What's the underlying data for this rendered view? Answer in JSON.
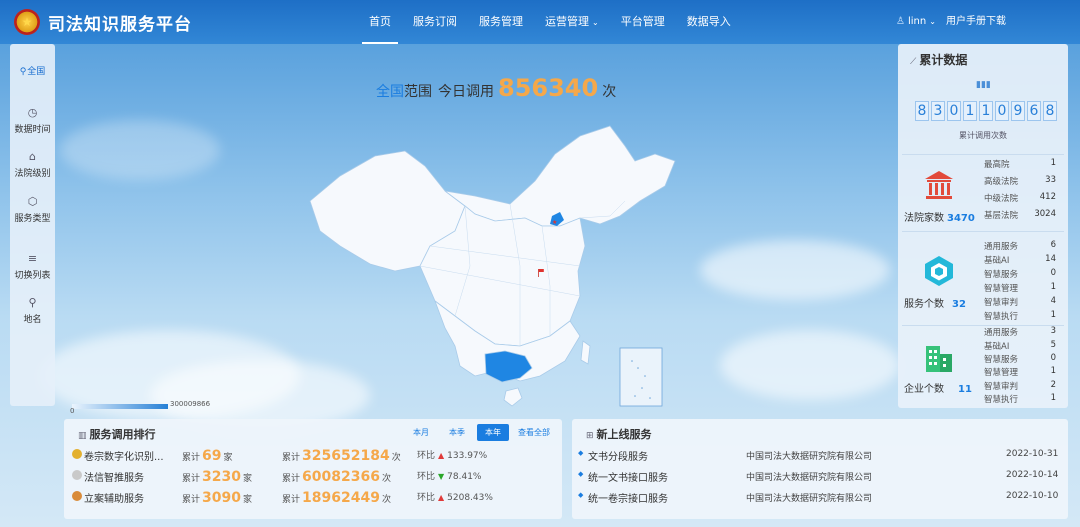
{
  "header": {
    "app_title": "司法知识服务平台",
    "nav": [
      {
        "label": "首页",
        "active": true
      },
      {
        "label": "服务订阅",
        "active": false
      },
      {
        "label": "服务管理",
        "active": false
      },
      {
        "label": "运营管理",
        "active": false,
        "dropdown": true
      },
      {
        "label": "平台管理",
        "active": false
      },
      {
        "label": "数据导入",
        "active": false
      }
    ],
    "username": "linn",
    "manual_link": "用户手册下载"
  },
  "sidebar": {
    "items": [
      {
        "label": "全国",
        "icon": "location-pin-icon"
      },
      {
        "label": "数据时间",
        "icon": "clock-icon"
      },
      {
        "label": "法院级别",
        "icon": "court-building-icon"
      },
      {
        "label": "服务类型",
        "icon": "hexagon-icon"
      },
      {
        "label": "切换列表",
        "icon": "list-icon"
      },
      {
        "label": "地名",
        "icon": "location-pin-icon"
      }
    ]
  },
  "map": {
    "scope": "全国",
    "scope_suffix": "范围",
    "prefix": "今日调用",
    "today_calls": "856340",
    "unit": "次",
    "legend_min": "0",
    "legend_max": "300009866",
    "highlight_color": "#1f86e3",
    "base_color": "#f6f9fd"
  },
  "cumulative": {
    "title": "累计数据",
    "total_digits": [
      "8",
      "3",
      "0",
      "1",
      "1",
      "0",
      "9",
      "6",
      "8"
    ],
    "total_label": "累计调用次数",
    "courts": {
      "label": "法院家数",
      "value": "3470",
      "items": [
        {
          "name": "最高院",
          "value": "1"
        },
        {
          "name": "高级法院",
          "value": "33"
        },
        {
          "name": "中级法院",
          "value": "412"
        },
        {
          "name": "基层法院",
          "value": "3024"
        }
      ]
    },
    "services": {
      "label": "服务个数",
      "value": "32",
      "items": [
        {
          "name": "通用服务",
          "value": "6"
        },
        {
          "name": "基础AI",
          "value": "14"
        },
        {
          "name": "智慧服务",
          "value": "0"
        },
        {
          "name": "智慧管理",
          "value": "1"
        },
        {
          "name": "智慧审判",
          "value": "4"
        },
        {
          "name": "智慧执行",
          "value": "1"
        }
      ]
    },
    "enterprises": {
      "label": "企业个数",
      "value": "11",
      "items": [
        {
          "name": "通用服务",
          "value": "3"
        },
        {
          "name": "基础AI",
          "value": "5"
        },
        {
          "name": "智慧服务",
          "value": "0"
        },
        {
          "name": "智慧管理",
          "value": "1"
        },
        {
          "name": "智慧审判",
          "value": "2"
        },
        {
          "name": "智慧执行",
          "value": "1"
        }
      ]
    }
  },
  "ranking": {
    "title": "服务调用排行",
    "tabs": [
      {
        "label": "本月",
        "active": false
      },
      {
        "label": "本季",
        "active": false
      },
      {
        "label": "本年",
        "active": true
      }
    ],
    "view_all": "查看全部",
    "total_prefix": "累计",
    "company_unit": "家",
    "calls_unit": "次",
    "ratio_label": "环比",
    "rows": [
      {
        "name": "卷宗数字化识别...",
        "courts": "69",
        "calls": "325652184",
        "ratio": "133.97%",
        "trend": "up",
        "medal": "#e3b02e"
      },
      {
        "name": "法信智推服务",
        "courts": "3230",
        "calls": "60082366",
        "ratio": "78.41%",
        "trend": "down",
        "medal": "#c9c9c9"
      },
      {
        "name": "立案辅助服务",
        "courts": "3090",
        "calls": "18962449",
        "ratio": "5208.43%",
        "trend": "up",
        "medal": "#d98b3a"
      }
    ]
  },
  "new_services": {
    "title": "新上线服务",
    "rows": [
      {
        "name": "文书分段服务",
        "org": "中国司法大数据研究院有限公司",
        "date": "2022-10-31"
      },
      {
        "name": "统一文书接口服务",
        "org": "中国司法大数据研究院有限公司",
        "date": "2022-10-14"
      },
      {
        "name": "统一卷宗接口服务",
        "org": "中国司法大数据研究院有限公司",
        "date": "2022-10-10"
      }
    ]
  }
}
